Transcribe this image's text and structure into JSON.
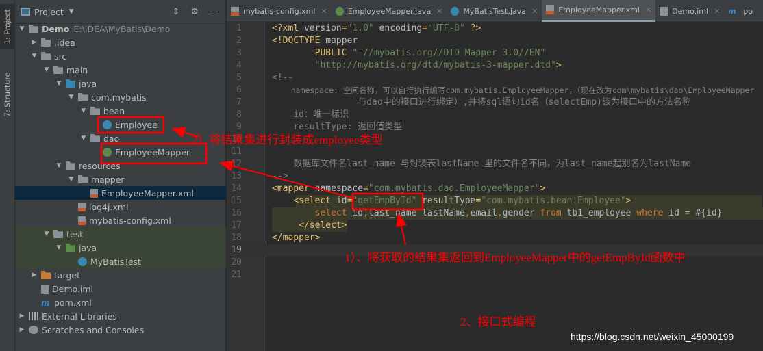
{
  "sidebar_stripe": {
    "project_tab": "1: Project",
    "structure_tab": "7: Structure"
  },
  "project_panel": {
    "title": "Project",
    "tools": [
      "collapse-icon",
      "gear-icon",
      "minimize-icon"
    ],
    "tree": [
      {
        "label": "Demo",
        "path": "E:\\IDEA\\MyBatis\\Demo",
        "depth": 0,
        "arrow": "down",
        "icon": "folder",
        "bold": true
      },
      {
        "label": ".idea",
        "depth": 1,
        "arrow": "right",
        "icon": "folder"
      },
      {
        "label": "src",
        "depth": 1,
        "arrow": "down",
        "icon": "folder"
      },
      {
        "label": "main",
        "depth": 2,
        "arrow": "down",
        "icon": "folder"
      },
      {
        "label": "java",
        "depth": 3,
        "arrow": "down",
        "icon": "src"
      },
      {
        "label": "com.mybatis",
        "depth": 4,
        "arrow": "down",
        "icon": "folder"
      },
      {
        "label": "bean",
        "depth": 5,
        "arrow": "down",
        "icon": "folder"
      },
      {
        "label": "Employee",
        "depth": 6,
        "icon": "class"
      },
      {
        "label": "dao",
        "depth": 5,
        "arrow": "down",
        "icon": "folder"
      },
      {
        "label": "EmployeeMapper",
        "depth": 6,
        "icon": "iface"
      },
      {
        "label": "resources",
        "depth": 3,
        "arrow": "down",
        "icon": "folder"
      },
      {
        "label": "mapper",
        "depth": 4,
        "arrow": "down",
        "icon": "folder"
      },
      {
        "label": "EmployeeMapper.xml",
        "depth": 5,
        "icon": "xml",
        "selected": true
      },
      {
        "label": "log4j.xml",
        "depth": 4,
        "icon": "xml"
      },
      {
        "label": "mybatis-config.xml",
        "depth": 4,
        "icon": "xml"
      },
      {
        "label": "test",
        "depth": 2,
        "arrow": "down",
        "icon": "folder",
        "test": true
      },
      {
        "label": "java",
        "depth": 3,
        "arrow": "down",
        "icon": "srcg",
        "test": true
      },
      {
        "label": "MyBatisTest",
        "depth": 4,
        "icon": "class",
        "test": true
      },
      {
        "label": "target",
        "depth": 1,
        "arrow": "right",
        "icon": "target"
      },
      {
        "label": "Demo.iml",
        "depth": 1,
        "icon": "iml"
      },
      {
        "label": "pom.xml",
        "depth": 1,
        "icon": "mvn"
      },
      {
        "label": "External Libraries",
        "depth": 0,
        "arrow": "right",
        "icon": "lib"
      },
      {
        "label": "Scratches and Consoles",
        "depth": 0,
        "arrow": "right",
        "icon": "scr"
      }
    ]
  },
  "editor_tabs": [
    {
      "label": "mybatis-config.xml",
      "icon": "xml"
    },
    {
      "label": "EmployeeMapper.java",
      "icon": "iface"
    },
    {
      "label": "MyBatisTest.java",
      "icon": "class"
    },
    {
      "label": "EmployeeMapper.xml",
      "icon": "xml",
      "active": true
    },
    {
      "label": "Demo.iml",
      "icon": "iml"
    },
    {
      "label": "po",
      "icon": "mvn"
    }
  ],
  "code_lines": [
    [
      [
        "tag",
        "<?xml "
      ],
      [
        "at",
        "version"
      ],
      [
        "tag",
        "="
      ],
      [
        "val",
        "\"1.0\""
      ],
      [
        "at",
        " encoding"
      ],
      [
        "tag",
        "="
      ],
      [
        "val",
        "\"UTF-8\""
      ],
      [
        "tag",
        " ?>"
      ]
    ],
    [
      [
        "tag",
        "<!DOCTYPE "
      ],
      [
        "at",
        "mapper"
      ]
    ],
    [
      [
        "pl",
        "        "
      ],
      [
        "tag",
        "PUBLIC "
      ],
      [
        "val",
        "\"-//mybatis.org//DTD Mapper 3.0//EN\""
      ]
    ],
    [
      [
        "pl",
        "        "
      ],
      [
        "val",
        "\"http://mybatis.org/dtd/mybatis-3-mapper.dtd\""
      ],
      [
        "tag",
        ">"
      ]
    ],
    [
      [
        "cm",
        "<!--"
      ]
    ],
    [
      [
        "cm",
        "    namespace: 空间名称，可以自行执行编写com.mybatis.EmployeeMapper，（现在改为com\\mybatis\\dao\\EmployeeMapper"
      ]
    ],
    [
      [
        "cm",
        "                与dao中的接口进行绑定）,并将sql语句id名（selectEmp)该为接口中的方法名称"
      ]
    ],
    [
      [
        "cm",
        "    id：唯一标识"
      ]
    ],
    [
      [
        "cm",
        "    resultType: 返回值类型"
      ]
    ],
    [
      [
        "cm",
        ""
      ]
    ],
    [
      [
        "cm",
        ""
      ]
    ],
    [
      [
        "cm",
        "    数据库文件名last_name 与封装表lastName 里的文件名不同，为last_name起别名为lastName"
      ]
    ],
    [
      [
        "cm",
        "-->"
      ]
    ],
    [
      [
        "tag",
        "<mapper "
      ],
      [
        "at",
        "namespace"
      ],
      [
        "tag",
        "="
      ],
      [
        "val",
        "\"com.mybatis.dao.EmployeeMapper\""
      ],
      [
        "tag",
        ">"
      ]
    ],
    [
      [
        "pl",
        "    "
      ],
      [
        "tag",
        "<select "
      ],
      [
        "at",
        "id"
      ],
      [
        "tag",
        "="
      ],
      [
        "val",
        "\"getEmpById\""
      ],
      [
        "at",
        " resultType"
      ],
      [
        "tag",
        "="
      ],
      [
        "val",
        "\"com.mybatis.bean.Employee\""
      ],
      [
        "tag",
        ">"
      ]
    ],
    [
      [
        "pl",
        "        "
      ],
      [
        "kw",
        "select "
      ],
      [
        "pl",
        "id"
      ],
      [
        "kw",
        ","
      ],
      [
        "pl",
        "last_name lastName"
      ],
      [
        "kw",
        ","
      ],
      [
        "pl",
        "email"
      ],
      [
        "kw",
        ","
      ],
      [
        "pl",
        "gender "
      ],
      [
        "kw",
        "from "
      ],
      [
        "pl",
        "tb1_employee "
      ],
      [
        "kw",
        "where "
      ],
      [
        "pl",
        "id = #{id}"
      ]
    ],
    [
      [
        "pl",
        "     "
      ],
      [
        "tag",
        "</select>"
      ]
    ],
    [
      [
        "tag",
        "</mapper>"
      ]
    ],
    [
      [
        "pl",
        ""
      ]
    ],
    [
      [
        "pl",
        ""
      ]
    ],
    [
      [
        "pl",
        ""
      ]
    ]
  ],
  "current_line": 19,
  "annotations": {
    "a1": "1）、将获取的结果集返回到EmployeeMapper中的getEmpById函数中",
    "a2": "2）将结果集进行封装成employee类型",
    "a3": "2、接口式编程"
  },
  "watermark": "https://blog.csdn.net/weixin_45000199",
  "colors": {
    "annotation": "#ff0000",
    "editor_bg": "#2b2b2b",
    "panel_bg": "#3c3f41"
  }
}
